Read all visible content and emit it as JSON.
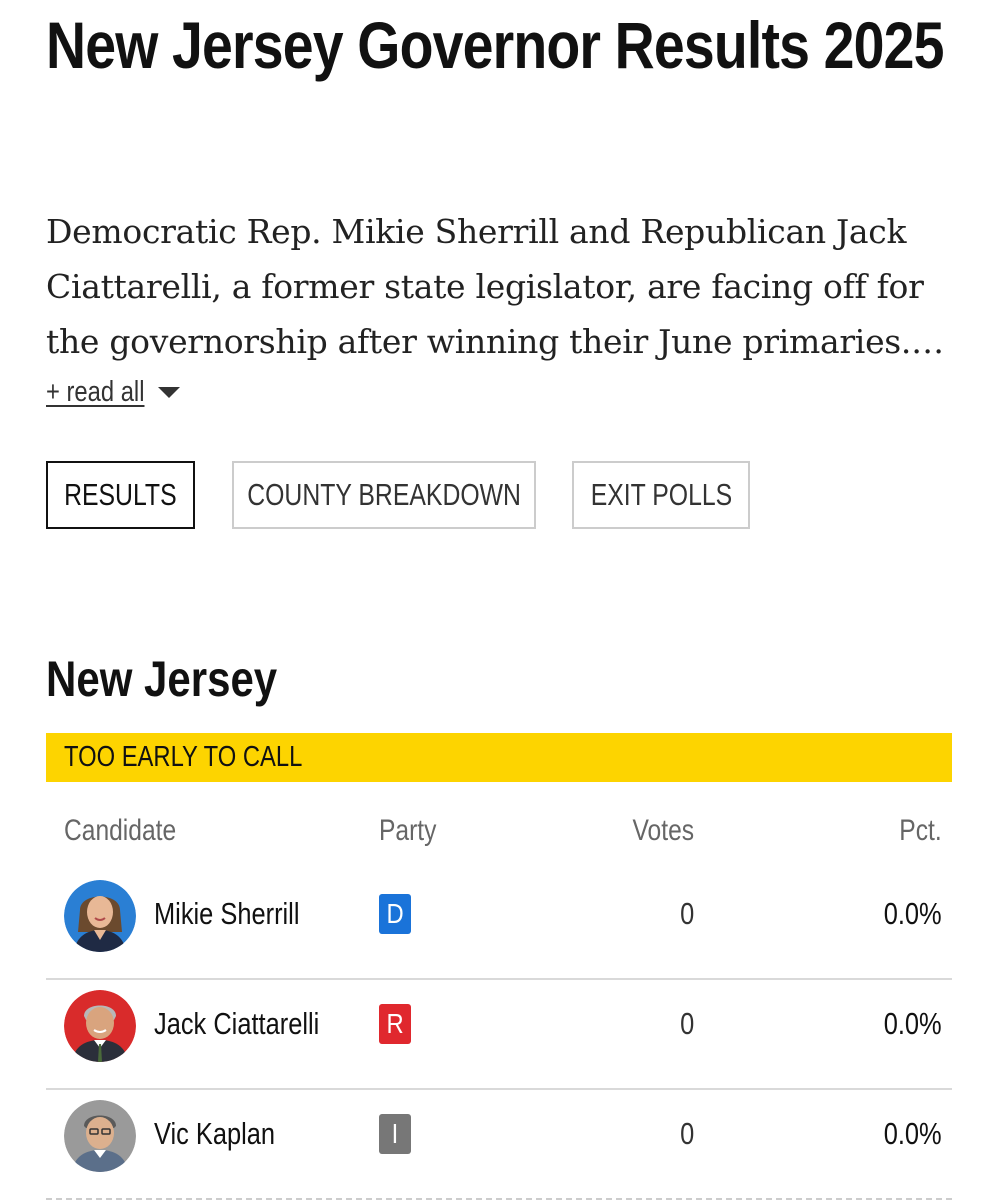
{
  "page": {
    "title": "New Jersey Governor Results 2025",
    "lede": "Democratic Rep. Mikie Sherrill and Republican Jack Ciattarelli, a former state legislator, are facing off for the governorship after winning their June primaries.…",
    "read_all_label": "+ read all"
  },
  "tabs": [
    {
      "label": "RESULTS",
      "active": true
    },
    {
      "label": "COUNTY BREAKDOWN",
      "active": false
    },
    {
      "label": "EXIT POLLS",
      "active": false
    }
  ],
  "race": {
    "state": "New Jersey",
    "call_status": "TOO EARLY TO CALL",
    "call_color": "#fdd400",
    "headers": {
      "candidate": "Candidate",
      "party": "Party",
      "votes": "Votes",
      "pct": "Pct."
    },
    "candidates": [
      {
        "name": "Mikie Sherrill",
        "party": "D",
        "party_color": "#1a73d9",
        "votes": "0",
        "pct": "0.0%",
        "photo_bg": "#2a7fd4"
      },
      {
        "name": "Jack Ciattarelli",
        "party": "R",
        "party_color": "#e0282e",
        "votes": "0",
        "pct": "0.0%",
        "photo_bg": "#d92b2b"
      },
      {
        "name": "Vic Kaplan",
        "party": "I",
        "party_color": "#777777",
        "votes": "0",
        "pct": "0.0%",
        "photo_bg": "#9a9a9a"
      }
    ]
  }
}
